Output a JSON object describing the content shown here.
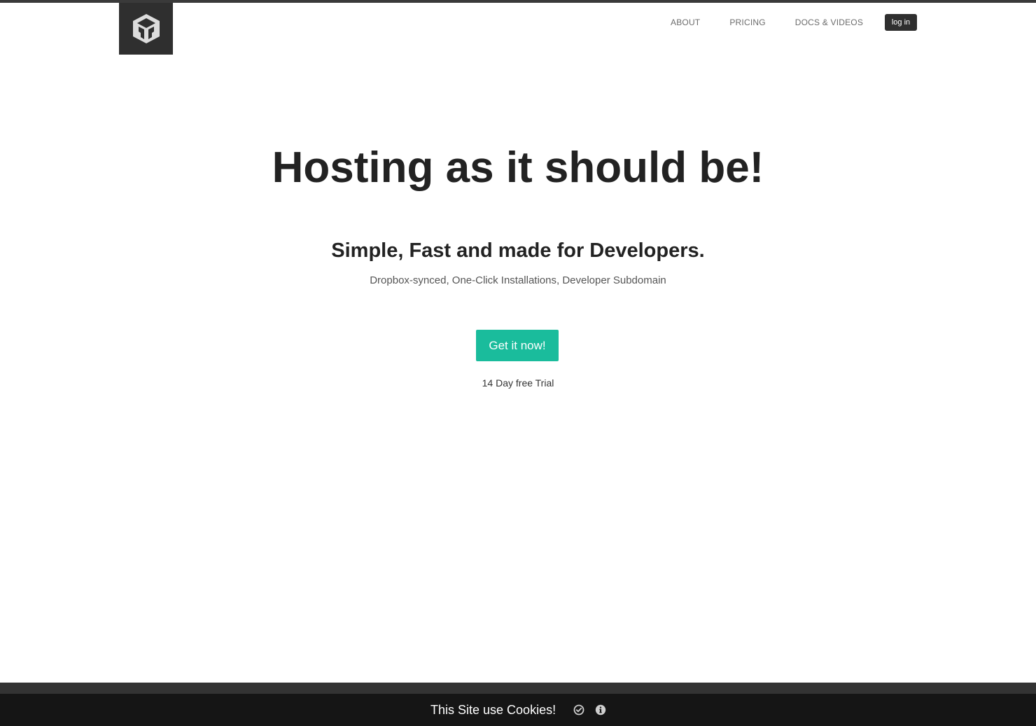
{
  "colors": {
    "top_strip": "#3a3a3a",
    "logo_bg": "#2f2f2f",
    "nav_text": "#6b6b6b",
    "login_bg": "#2f2f2f",
    "cta_bg": "#1abc9c",
    "heading": "#222222",
    "footer_band": "#333333",
    "cookie_bar": "#151515"
  },
  "header": {
    "logo_icon": "cube-logo-icon",
    "nav": [
      {
        "label": "ABOUT"
      },
      {
        "label": "PRICING"
      },
      {
        "label": "DOCS & VIDEOS"
      }
    ],
    "login_label": "log in"
  },
  "hero": {
    "title": "Hosting as it should be!",
    "subtitle": "Simple, Fast and made for Developers.",
    "features": "Dropbox-synced, One-Click Installations, Developer Subdomain",
    "cta_label": "Get it now!",
    "trial_note": "14 Day free Trial"
  },
  "cookie_bar": {
    "text": "This Site use Cookies!",
    "accept_icon": "check-circle-icon",
    "info_icon": "info-circle-icon"
  }
}
